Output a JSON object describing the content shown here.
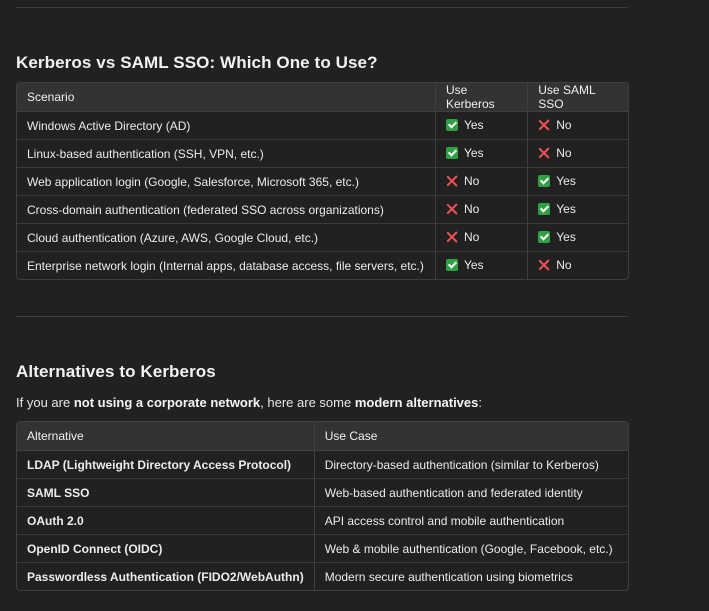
{
  "section1": {
    "title": "Kerberos vs SAML SSO: Which One to Use?",
    "columns": [
      "Scenario",
      "Use Kerberos",
      "Use SAML SSO"
    ],
    "rows": [
      {
        "scenario": "Windows Active Directory (AD)",
        "kerberos": "Yes",
        "saml": "No",
        "kerberos_icon": "check-icon",
        "saml_icon": "cross-icon"
      },
      {
        "scenario": "Linux-based authentication (SSH, VPN, etc.)",
        "kerberos": "Yes",
        "saml": "No",
        "kerberos_icon": "check-icon",
        "saml_icon": "cross-icon"
      },
      {
        "scenario": "Web application login (Google, Salesforce, Microsoft 365, etc.)",
        "kerberos": "No",
        "saml": "Yes",
        "kerberos_icon": "cross-icon",
        "saml_icon": "check-icon"
      },
      {
        "scenario": "Cross-domain authentication (federated SSO across organizations)",
        "kerberos": "No",
        "saml": "Yes",
        "kerberos_icon": "cross-icon",
        "saml_icon": "check-icon"
      },
      {
        "scenario": "Cloud authentication (Azure, AWS, Google Cloud, etc.)",
        "kerberos": "No",
        "saml": "Yes",
        "kerberos_icon": "cross-icon",
        "saml_icon": "check-icon"
      },
      {
        "scenario": "Enterprise network login (Internal apps, database access, file servers, etc.)",
        "kerberos": "Yes",
        "saml": "No",
        "kerberos_icon": "check-icon",
        "saml_icon": "cross-icon"
      }
    ]
  },
  "section2": {
    "title": "Alternatives to Kerberos",
    "intro": {
      "part1": "If you are ",
      "bold1": "not using a corporate network",
      "part2": ", here are some ",
      "bold2": "modern alternatives",
      "part3": ":"
    },
    "columns": [
      "Alternative",
      "Use Case"
    ],
    "rows": [
      {
        "alternative": "LDAP (Lightweight Directory Access Protocol)",
        "use_case": "Directory-based authentication (similar to Kerberos)"
      },
      {
        "alternative": "SAML SSO",
        "use_case": "Web-based authentication and federated identity"
      },
      {
        "alternative": "OAuth 2.0",
        "use_case": "API access control and mobile authentication"
      },
      {
        "alternative": "OpenID Connect (OIDC)",
        "use_case": "Web & mobile authentication (Google, Facebook, etc.)"
      },
      {
        "alternative": "Passwordless Authentication (FIDO2/WebAuthn)",
        "use_case": "Modern secure authentication using biometrics"
      }
    ]
  },
  "colors": {
    "background": "#212121",
    "header_row": "#333333",
    "border": "#3f3f3f",
    "check": "#2ea043",
    "cross": "#f05252",
    "text": "#ececec"
  }
}
